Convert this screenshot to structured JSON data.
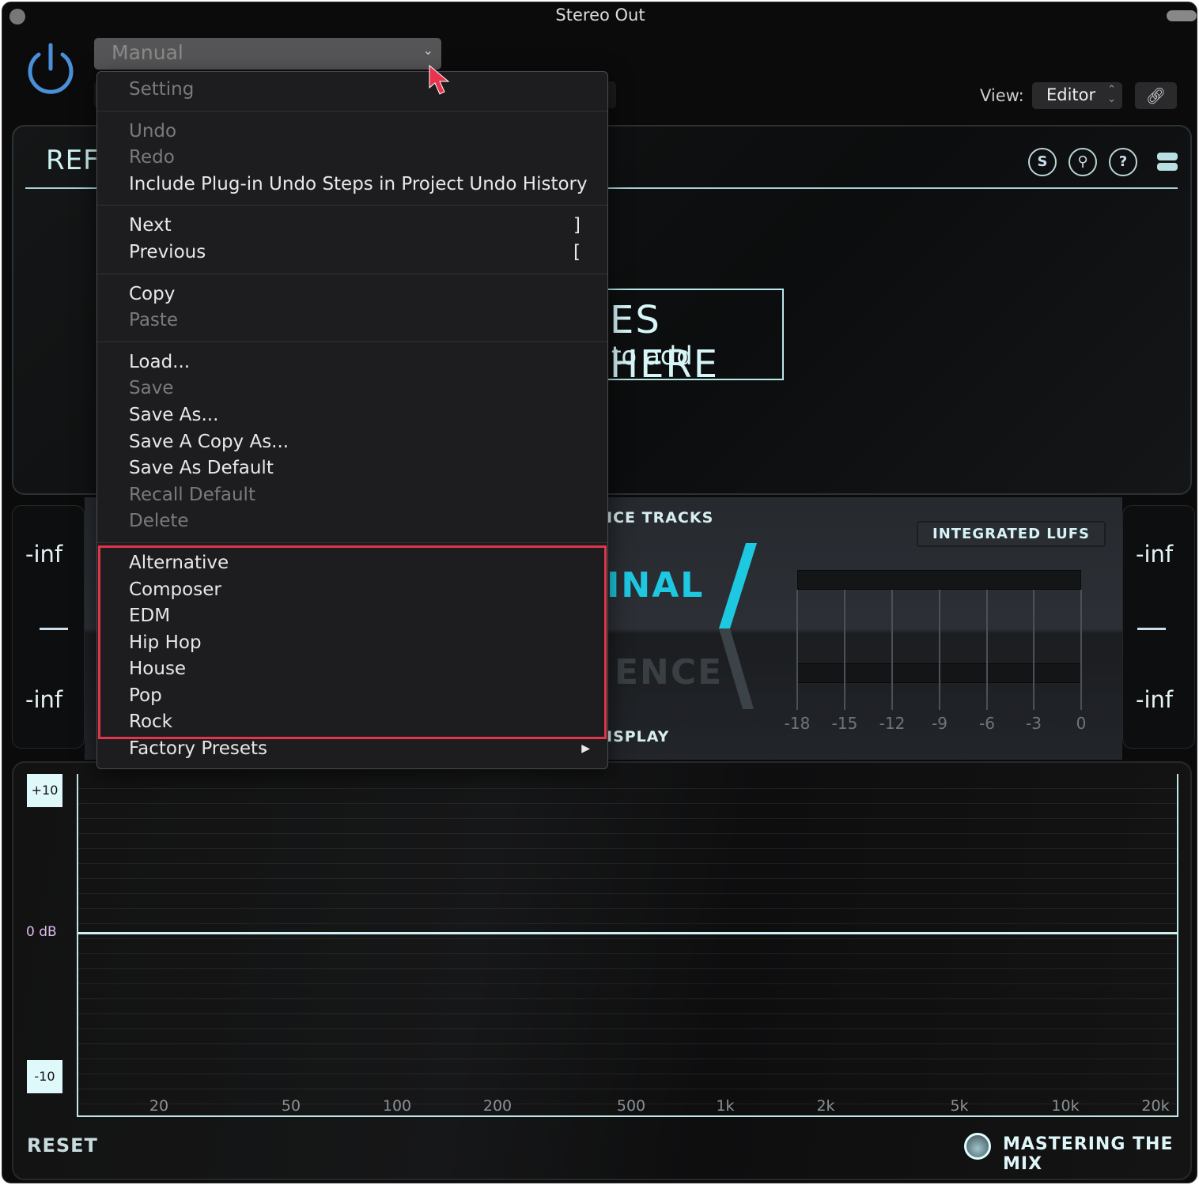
{
  "window": {
    "title": "Stereo Out"
  },
  "header": {
    "preset_value": "Manual",
    "view_label": "View:",
    "view_value": "Editor"
  },
  "panel": {
    "title": "REF",
    "drop_line1": "ES HERE",
    "drop_line2": "to add",
    "icons": [
      "solo-icon",
      "key-icon",
      "help-icon",
      "menu-stack-icon"
    ],
    "icon_labels": [
      "S",
      "?"
    ]
  },
  "meters": {
    "left_top": "-inf",
    "left_bottom": "-inf",
    "right_top": "-inf",
    "right_bottom": "-inf"
  },
  "tabs": {
    "reference_tracks": "ICE TRACKS",
    "original": "INAL",
    "reference": "ENCE",
    "display": "ISPLAY"
  },
  "lufs": {
    "label": "INTEGRATED LUFS",
    "ticks": [
      "-18",
      "-15",
      "-12",
      "-9",
      "-6",
      "-3",
      "0"
    ]
  },
  "eq": {
    "y_labels": {
      "top": "+10",
      "mid": "0 dB",
      "bottom": "-10"
    },
    "x_ticks": [
      "20",
      "50",
      "100",
      "200",
      "500",
      "1k",
      "2k",
      "5k",
      "10k",
      "20k"
    ],
    "reset": "RESET"
  },
  "brand": {
    "name": "MASTERING THE MIX"
  },
  "menu": {
    "groups": [
      [
        {
          "label": "Setting",
          "disabled": true
        }
      ],
      [
        {
          "label": "Undo",
          "disabled": true
        },
        {
          "label": "Redo",
          "disabled": true
        },
        {
          "label": "Include Plug-in Undo Steps in Project Undo History"
        }
      ],
      [
        {
          "label": "Next",
          "shortcut": "]"
        },
        {
          "label": "Previous",
          "shortcut": "["
        }
      ],
      [
        {
          "label": "Copy"
        },
        {
          "label": "Paste",
          "disabled": true
        }
      ],
      [
        {
          "label": "Load..."
        },
        {
          "label": "Save",
          "disabled": true
        },
        {
          "label": "Save As..."
        },
        {
          "label": "Save A Copy As..."
        },
        {
          "label": "Save As Default"
        },
        {
          "label": "Recall Default",
          "disabled": true
        },
        {
          "label": "Delete",
          "disabled": true
        }
      ],
      [
        {
          "label": "Alternative"
        },
        {
          "label": "Composer"
        },
        {
          "label": "EDM"
        },
        {
          "label": "Hip Hop"
        },
        {
          "label": "House"
        },
        {
          "label": "Pop"
        },
        {
          "label": "Rock"
        },
        {
          "label": "Factory Presets",
          "submenu": true
        }
      ]
    ]
  },
  "colors": {
    "accent": "#1ec8e0",
    "highlight": "#e0354b",
    "power": "#4a90d9"
  }
}
